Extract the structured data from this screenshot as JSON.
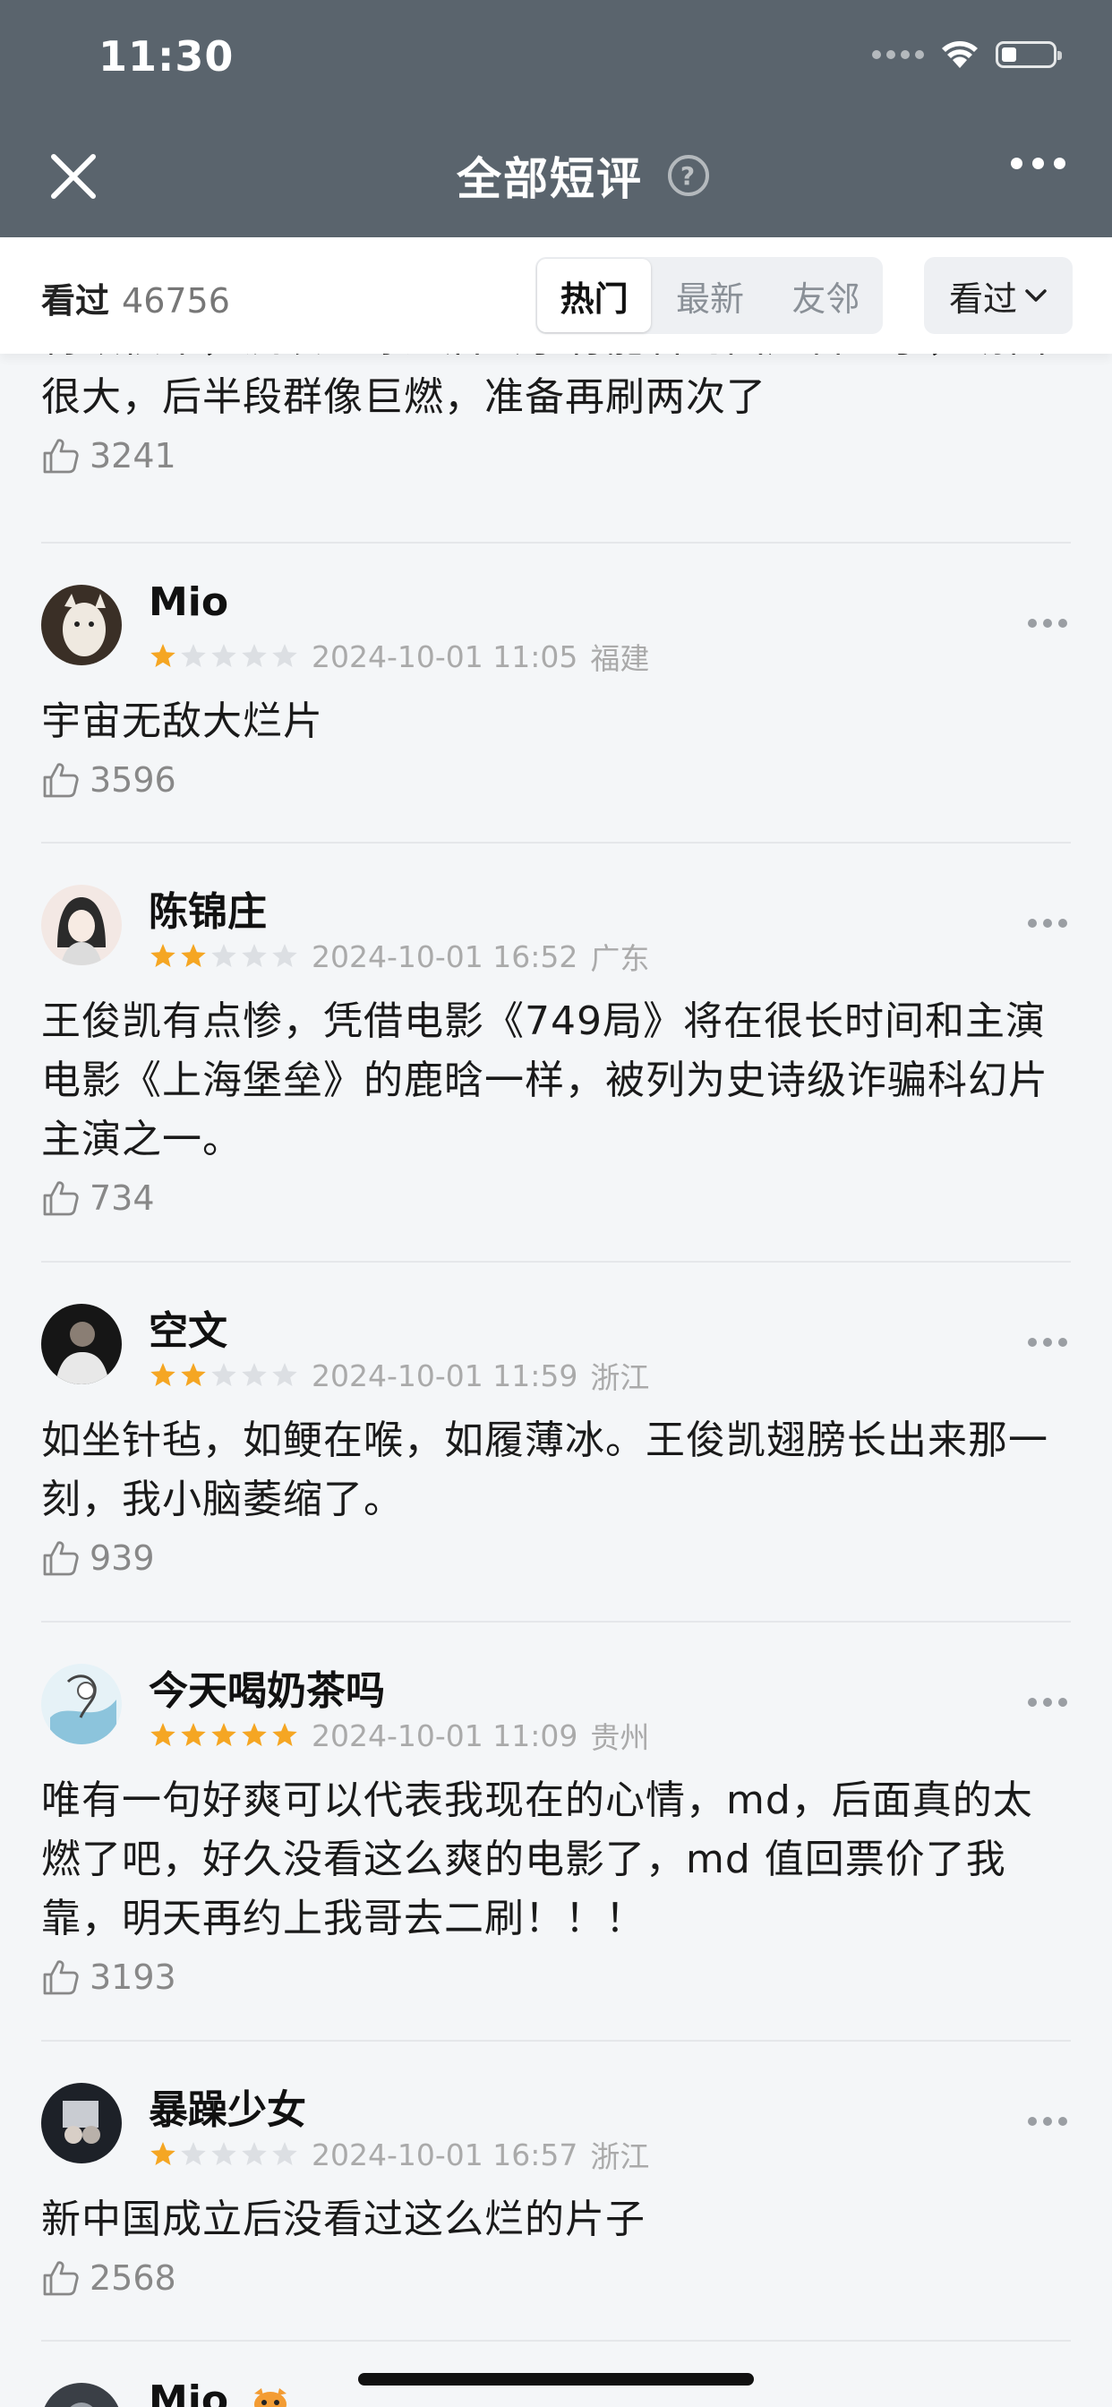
{
  "status_bar": {
    "time": "11:30"
  },
  "nav": {
    "title": "全部短评",
    "help_symbol": "?"
  },
  "filter": {
    "watched_label": "看过",
    "watched_count": "46756",
    "tabs": [
      {
        "label": "热门",
        "active": true
      },
      {
        "label": "最新",
        "active": false
      },
      {
        "label": "友邻",
        "active": false
      }
    ],
    "dropdown_label": "看过"
  },
  "partial_comment": {
    "text_line1": "特效很牛，流浪地球之后终于有能看的国产科幻了，场面",
    "text_line2": "很大，后半段群像巨燃，准备再刷两次了",
    "likes": "3241"
  },
  "comments": [
    {
      "name": "Mio",
      "rating": 1,
      "datetime": "2024-10-01 11:05",
      "location": "福建",
      "lines": [
        "宇宙无敌大烂片"
      ],
      "likes": "3596"
    },
    {
      "name": "陈锦庄",
      "rating": 2,
      "datetime": "2024-10-01 16:52",
      "location": "广东",
      "lines": [
        "王俊凯有点惨，凭借电影《749局》将在很长时间和主演",
        "电影《上海堡垒》的鹿晗一样，被列为史诗级诈骗科幻片",
        "主演之一。"
      ],
      "likes": "734"
    },
    {
      "name": "空文",
      "rating": 2,
      "datetime": "2024-10-01 11:59",
      "location": "浙江",
      "lines": [
        "如坐针毡，如鲠在喉，如履薄冰。王俊凯翅膀长出来那一",
        "刻，我小脑萎缩了。"
      ],
      "likes": "939"
    },
    {
      "name": "今天喝奶茶吗",
      "rating": 5,
      "datetime": "2024-10-01 11:09",
      "location": "贵州",
      "lines": [
        "唯有一句好爽可以代表我现在的心情，md，后面真的太",
        "燃了吧，好久没看这么爽的电影了，md 值回票价了我",
        "靠，明天再约上我哥去二刷！！！"
      ],
      "likes": "3193"
    },
    {
      "name": "暴躁少女",
      "rating": 1,
      "datetime": "2024-10-01 16:57",
      "location": "浙江",
      "lines": [
        "新中国成立后没看过这么烂的片子"
      ],
      "likes": "2568"
    }
  ],
  "partial_bottom": {
    "name": "Mio"
  },
  "colors": {
    "header_bg": "#5a646d",
    "star_filled": "#f5a623",
    "star_empty": "#dcdfe3"
  }
}
